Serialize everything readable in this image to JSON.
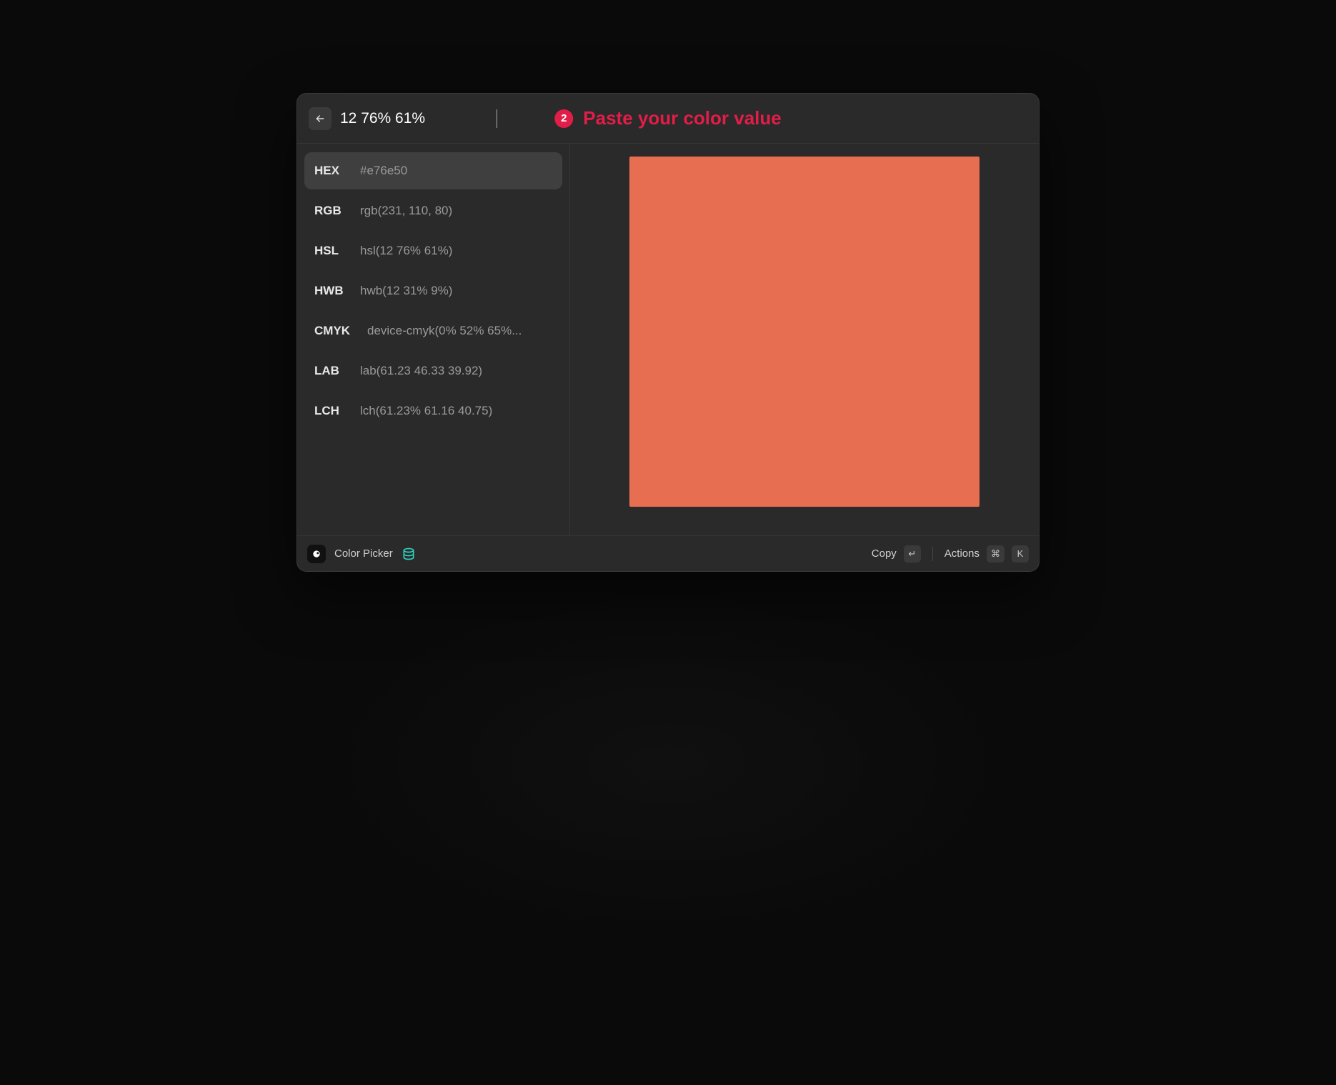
{
  "header": {
    "input_value": "12 76% 61%",
    "step_number": "2",
    "step_text": "Paste your color value"
  },
  "formats": [
    {
      "label": "HEX",
      "value": "#e76e50",
      "selected": true
    },
    {
      "label": "RGB",
      "value": "rgb(231, 110, 80)",
      "selected": false
    },
    {
      "label": "HSL",
      "value": "hsl(12 76% 61%)",
      "selected": false
    },
    {
      "label": "HWB",
      "value": "hwb(12 31% 9%)",
      "selected": false
    },
    {
      "label": "CMYK",
      "value": "device-cmyk(0% 52% 65%...",
      "selected": false
    },
    {
      "label": "LAB",
      "value": "lab(61.23 46.33 39.92)",
      "selected": false
    },
    {
      "label": "LCH",
      "value": "lch(61.23% 61.16 40.75)",
      "selected": false
    }
  ],
  "preview": {
    "swatch_color": "#e76e50"
  },
  "footer": {
    "app_name": "Color Picker",
    "copy_label": "Copy",
    "enter_key": "↵",
    "actions_label": "Actions",
    "cmd_key": "⌘",
    "k_key": "K"
  }
}
